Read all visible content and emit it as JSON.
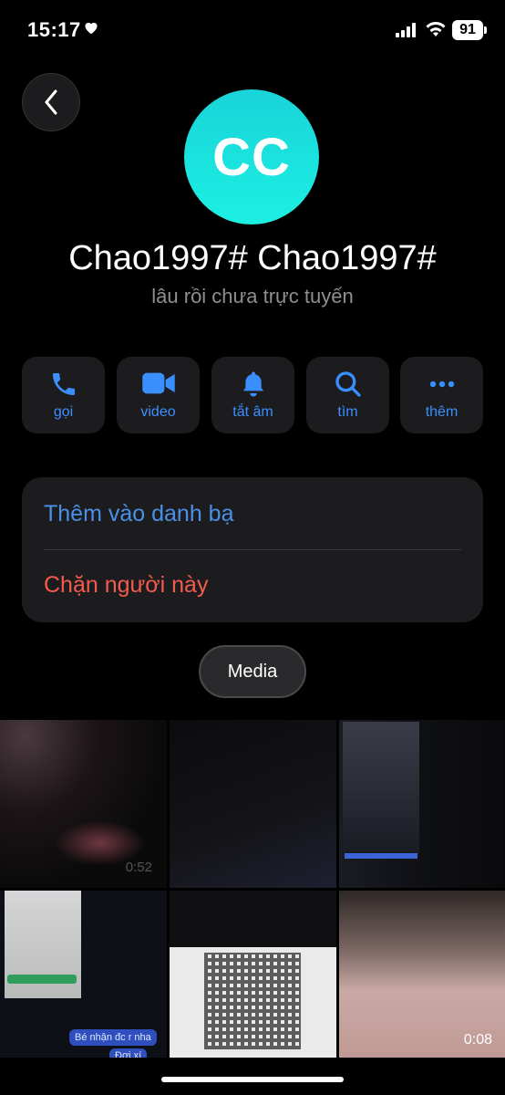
{
  "status_bar": {
    "time": "15:17",
    "battery": "91"
  },
  "contact": {
    "avatar_initials": "CC",
    "name": "Chao1997# Chao1997#",
    "presence": "lâu rồi chưa trực tuyến"
  },
  "actions": [
    {
      "label": "gọi",
      "icon": "phone-icon"
    },
    {
      "label": "video",
      "icon": "video-camera-icon"
    },
    {
      "label": "tắt âm",
      "icon": "bell-icon"
    },
    {
      "label": "tìm",
      "icon": "search-icon"
    },
    {
      "label": "thêm",
      "icon": "more-icon"
    }
  ],
  "options": {
    "add_contact": "Thêm vào danh bạ",
    "block": "Chặn người này"
  },
  "media": {
    "tab_label": "Media",
    "tiles": [
      {
        "type": "video",
        "duration": "0:52"
      },
      {
        "type": "photo"
      },
      {
        "type": "photo"
      },
      {
        "type": "photo",
        "chat_text_1": "Bé nhận đc r nha",
        "chat_text_2": "Đợi xí"
      },
      {
        "type": "photo"
      },
      {
        "type": "video",
        "duration": "0:08"
      }
    ]
  },
  "colors": {
    "accent": "#3a8fff",
    "destructive": "#f25b4e",
    "avatar": "#1cf0e3"
  }
}
